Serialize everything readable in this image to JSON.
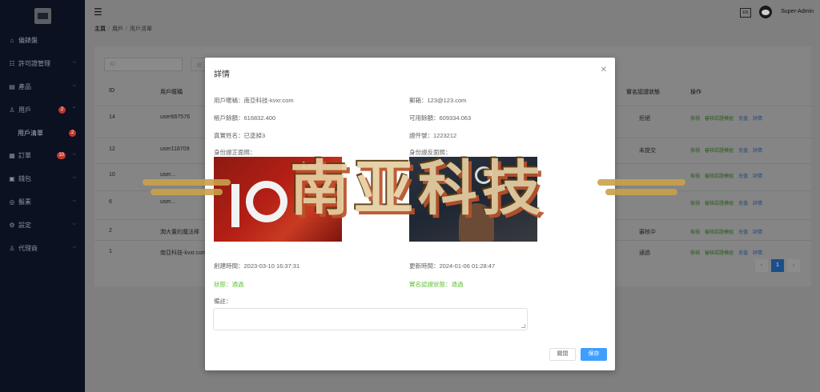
{
  "sidebar": {
    "items": [
      {
        "icon": "home-icon",
        "glyph": "⌂",
        "label": "儀錶盤",
        "chevron": false,
        "badge": ""
      },
      {
        "icon": "license-icon",
        "glyph": "☷",
        "label": "許可證管理",
        "chevron": true,
        "badge": ""
      },
      {
        "icon": "product-icon",
        "glyph": "▤",
        "label": "產品",
        "chevron": true,
        "badge": ""
      },
      {
        "icon": "user-icon",
        "glyph": "♙",
        "label": "用戶",
        "chevron": true,
        "badge": "2"
      }
    ],
    "sub_item": {
      "label": "用戶清單",
      "badge": "2"
    },
    "items_after": [
      {
        "icon": "order-icon",
        "glyph": "▦",
        "label": "訂單",
        "chevron": true,
        "badge": "10"
      },
      {
        "icon": "wallet-icon",
        "glyph": "▣",
        "label": "錢包",
        "chevron": true,
        "badge": ""
      },
      {
        "icon": "notice-icon",
        "glyph": "◎",
        "label": "鬍素",
        "chevron": true,
        "badge": ""
      },
      {
        "icon": "settings-icon",
        "glyph": "⚙",
        "label": "設定",
        "chevron": true,
        "badge": ""
      },
      {
        "icon": "agent-icon",
        "glyph": "♙",
        "label": "代理商",
        "chevron": true,
        "badge": ""
      }
    ]
  },
  "header": {
    "lang": "EN",
    "username": "Super-Admin",
    "breadcrumb": [
      "主頁",
      "用戶",
      "用戶清單"
    ]
  },
  "table": {
    "filter_placeholder": "ID",
    "filter2_placeholder": "用",
    "columns": {
      "id": "ID",
      "username": "用戶暱稱",
      "verify": "實名認證狀態",
      "ops": "操作"
    },
    "rows": [
      {
        "id": "14",
        "username": "user667576",
        "status": "拒絕"
      },
      {
        "id": "12",
        "username": "user118709",
        "status": "未提交"
      },
      {
        "id": "10",
        "username": "user...",
        "status": ""
      },
      {
        "id": "6",
        "username": "user...",
        "status": ""
      },
      {
        "id": "2",
        "username": "潤大董的魔法棒",
        "status": "審核中"
      },
      {
        "id": "1",
        "username": "南亞科技-kvxr.com",
        "status": "通過"
      }
    ],
    "ops": {
      "view": "檢視",
      "audit": "審核認證模組",
      "recharge": "充值",
      "detail": "詳情"
    },
    "page": "1"
  },
  "modal": {
    "title": "詳情",
    "nickname": "用戶暱稱：南亞科技-kvxr.com",
    "email": "郵箱：123@123.com",
    "balance": "帳戶餘額：616832.400",
    "available": "可用餘額：609334.063",
    "realname": "真實姓名：已塗掉3",
    "id_number": "證件號：1223212",
    "id_front_label": "身份證正面照：",
    "id_back_label": "身份證反面照：",
    "id_front_text": "Lon",
    "created": "創建時間：2023-03-10 16:37:31",
    "updated": "更新時間：2024-01-06 01:28:47",
    "status": "狀態：通過",
    "verify_status": "實名認證狀態：通過",
    "remark_label": "備註：",
    "close_button": "關閉",
    "save_button": "保存"
  },
  "watermark": {
    "text": "南亚科技"
  },
  "colors": {
    "primary": "#409eff",
    "success": "#67c23a",
    "sidebar": "#0b1120",
    "badge": "#c0392b"
  }
}
